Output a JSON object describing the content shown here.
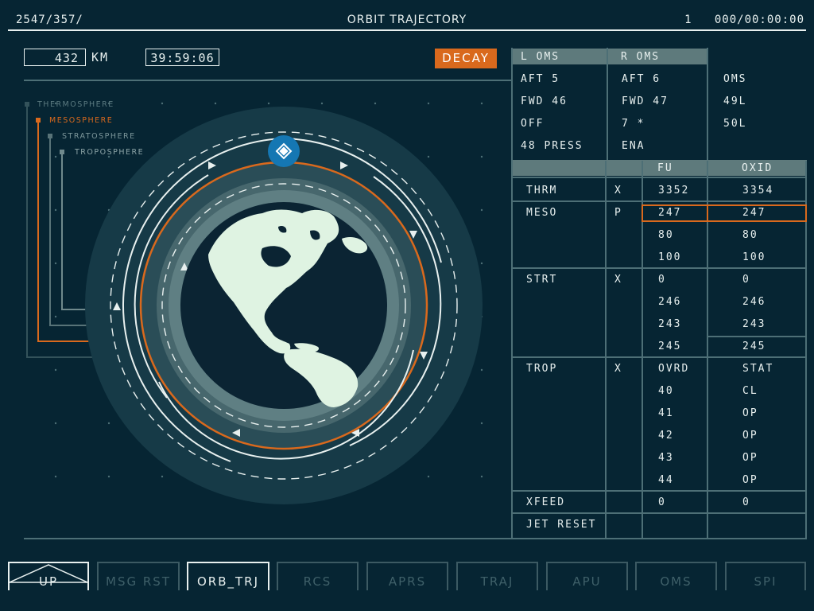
{
  "header": {
    "left": "2547/357/",
    "title": "ORBIT TRAJECTORY",
    "right": "1   000/00:00:00"
  },
  "status": {
    "altitude": "432",
    "altitude_unit": "KM",
    "timer": "39:59:06",
    "decay_button": "DECAY"
  },
  "layers": [
    "THERMOSPHERE",
    "MESOSPHERE",
    "STRATOSPHERE",
    "TROPOSPHERE"
  ],
  "oms_panel": {
    "left_header": "L OMS",
    "right_header": "R OMS",
    "left_items": [
      "AFT 5",
      "FWD 46",
      "OFF",
      "48 PRESS"
    ],
    "right_items": [
      "AFT 6",
      "FWD 47",
      "7 *",
      "ENA"
    ],
    "oms_items": [
      "OMS",
      "49L",
      "50L"
    ]
  },
  "prop_table": {
    "col_fu": "FU",
    "col_oxid": "OXID",
    "rows": [
      {
        "label": "THRM",
        "flag": "X",
        "fu": [
          "3352"
        ],
        "oxid": [
          "3354"
        ]
      },
      {
        "label": "MESO",
        "flag": "P",
        "fu": [
          "247",
          "80",
          "100"
        ],
        "oxid": [
          "247",
          "80",
          "100"
        ]
      },
      {
        "label": "STRT",
        "flag": "X",
        "fu": [
          "0",
          "246",
          "243",
          "245"
        ],
        "oxid": [
          "0",
          "246",
          "243",
          "245"
        ]
      },
      {
        "label": "TROP",
        "flag": "X",
        "fu": [
          "OVRD",
          "40",
          "41",
          "42",
          "43",
          "44"
        ],
        "oxid": [
          "STAT",
          "CL",
          "OP",
          "OP",
          "OP",
          "OP"
        ]
      },
      {
        "label": "XFEED",
        "flag": "",
        "fu": [
          "0"
        ],
        "oxid": [
          "0"
        ]
      },
      {
        "label": "JET RESET",
        "flag": "",
        "fu": [
          ""
        ],
        "oxid": [
          ""
        ]
      }
    ]
  },
  "tabs": [
    {
      "label": "UP",
      "active": true
    },
    {
      "label": "MSG RST",
      "active": false
    },
    {
      "label": "ORB_TRJ",
      "active": true
    },
    {
      "label": "RCS",
      "active": false
    },
    {
      "label": "APRS",
      "active": false
    },
    {
      "label": "TRAJ",
      "active": false
    },
    {
      "label": "APU",
      "active": false
    },
    {
      "label": "OMS",
      "active": false
    },
    {
      "label": "SPI",
      "active": false
    }
  ],
  "colors": {
    "background": "#062533",
    "accent_orange": "#d9691d",
    "satellite_blue": "#1577b3",
    "foreground": "#e8f0ef"
  }
}
